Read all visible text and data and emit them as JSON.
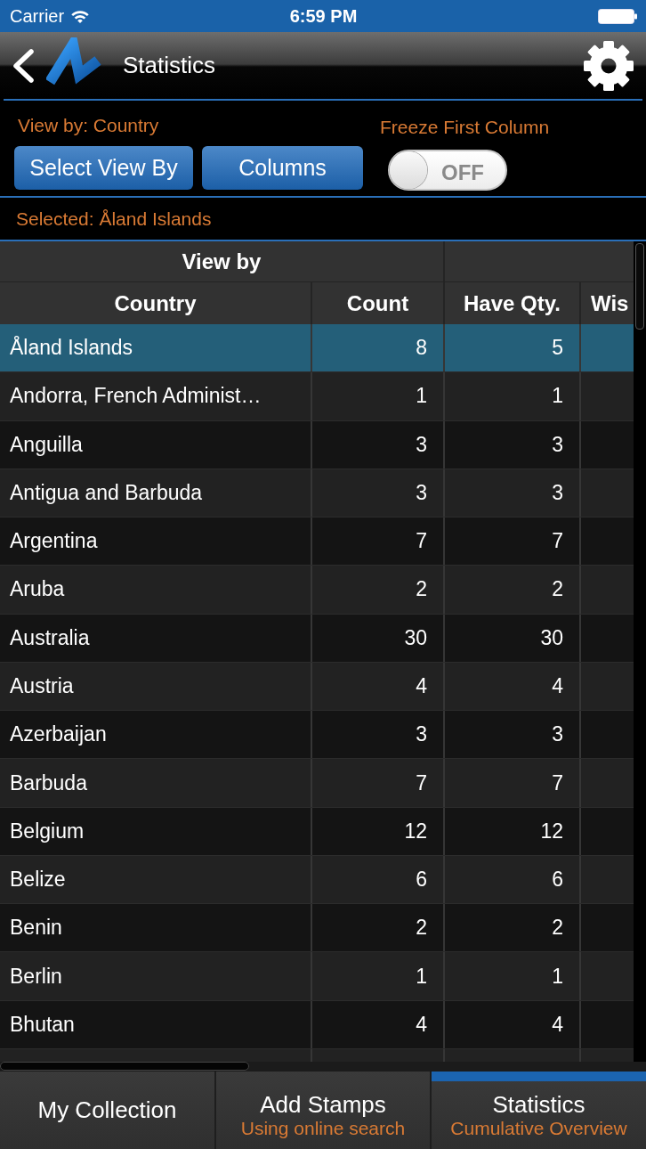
{
  "status_bar": {
    "carrier": "Carrier",
    "time": "6:59 PM"
  },
  "nav_bar": {
    "title": "Statistics"
  },
  "controls": {
    "view_by_label": "View by: Country",
    "buttons": [
      "Select View By",
      "Columns"
    ],
    "freeze_label": "Freeze First Column",
    "freeze_toggle": {
      "on": false,
      "label": "OFF"
    }
  },
  "selected_label": "Selected: Åland Islands",
  "table": {
    "group_header": "View by",
    "columns": [
      "Country",
      "Count",
      "Have Qty.",
      "Wis"
    ],
    "rows": [
      {
        "cells": [
          "Åland Islands",
          "8",
          "5"
        ],
        "selected": true
      },
      {
        "cells": [
          "Andorra, French Administ…",
          "1",
          "1"
        ],
        "selected": false
      },
      {
        "cells": [
          "Anguilla",
          "3",
          "3"
        ],
        "selected": false
      },
      {
        "cells": [
          "Antigua and Barbuda",
          "3",
          "3"
        ],
        "selected": false
      },
      {
        "cells": [
          "Argentina",
          "7",
          "7"
        ],
        "selected": false
      },
      {
        "cells": [
          "Aruba",
          "2",
          "2"
        ],
        "selected": false
      },
      {
        "cells": [
          "Australia",
          "30",
          "30"
        ],
        "selected": false
      },
      {
        "cells": [
          "Austria",
          "4",
          "4"
        ],
        "selected": false
      },
      {
        "cells": [
          "Azerbaijan",
          "3",
          "3"
        ],
        "selected": false
      },
      {
        "cells": [
          "Barbuda",
          "7",
          "7"
        ],
        "selected": false
      },
      {
        "cells": [
          "Belgium",
          "12",
          "12"
        ],
        "selected": false
      },
      {
        "cells": [
          "Belize",
          "6",
          "6"
        ],
        "selected": false
      },
      {
        "cells": [
          "Benin",
          "2",
          "2"
        ],
        "selected": false
      },
      {
        "cells": [
          "Berlin",
          "1",
          "1"
        ],
        "selected": false
      },
      {
        "cells": [
          "Bhutan",
          "4",
          "4"
        ],
        "selected": false
      }
    ]
  },
  "tab_bar": [
    {
      "label": "My Collection",
      "selected": false
    },
    {
      "label": "Add Stamps",
      "subtitle": "Using online search",
      "selected": false
    },
    {
      "label": "Statistics",
      "subtitle": "Cumulative Overview",
      "selected": true
    }
  ]
}
